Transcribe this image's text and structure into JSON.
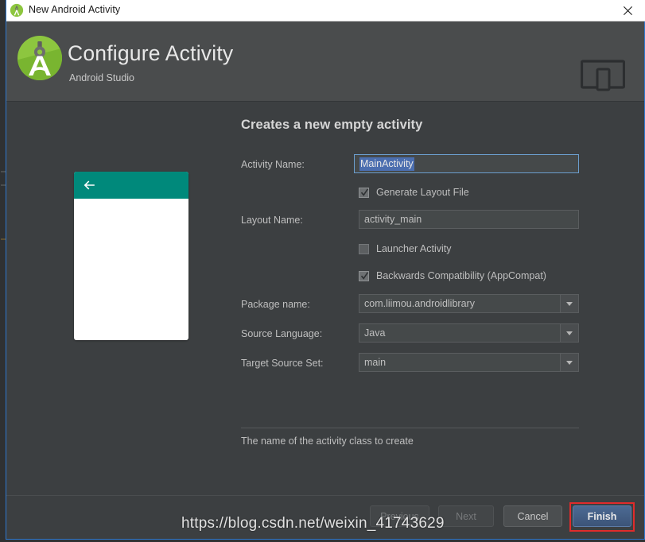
{
  "titlebar": {
    "title": "New Android Activity",
    "icon": "android-studio-icon",
    "close_label": "×"
  },
  "header": {
    "title": "Configure Activity",
    "subtitle": "Android Studio",
    "logo_icon": "android-studio-logo",
    "device_icon": "tablet-phone-preview-icon"
  },
  "main": {
    "section_title": "Creates a new empty activity",
    "preview": {
      "back_icon": "back-arrow-icon",
      "toolbar_color": "#00897b"
    },
    "fields": {
      "activity_name": {
        "label": "Activity Name:",
        "value": "MainActivity",
        "selected": true
      },
      "generate_layout_file": {
        "label": "Generate Layout File",
        "checked": true
      },
      "layout_name": {
        "label": "Layout Name:",
        "value": "activity_main"
      },
      "launcher_activity": {
        "label": "Launcher Activity",
        "checked": false
      },
      "backwards_compatibility": {
        "label": "Backwards Compatibility (AppCompat)",
        "checked": true
      },
      "package_name": {
        "label": "Package name:",
        "value": "com.liimou.androidlibrary"
      },
      "source_language": {
        "label": "Source Language:",
        "value": "Java"
      },
      "target_source_set": {
        "label": "Target Source Set:",
        "value": "main"
      }
    },
    "hint": "The name of the activity class to create"
  },
  "footer": {
    "previous": "Previous",
    "next": "Next",
    "cancel": "Cancel",
    "finish": "Finish"
  },
  "watermark": "https://blog.csdn.net/weixin_41743629",
  "colors": {
    "accent_blue": "#2f79d0",
    "focus_red": "#e02b2b",
    "teal": "#00897b",
    "selection_blue": "#4b6eaf"
  }
}
